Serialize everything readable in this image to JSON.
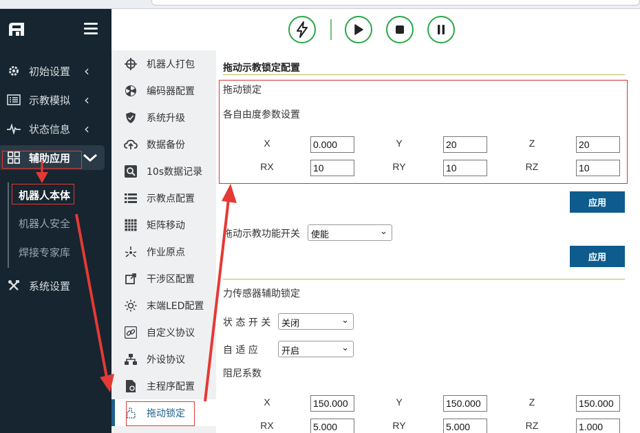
{
  "sidebar": {
    "items": [
      {
        "label": "初始设置",
        "icon": "gear-icon"
      },
      {
        "label": "示教模拟",
        "icon": "list-icon"
      },
      {
        "label": "状态信息",
        "icon": "pulse-icon"
      },
      {
        "label": "辅助应用",
        "icon": "grid-icon"
      },
      {
        "label": "系统设置",
        "icon": "tools-icon"
      }
    ],
    "sub_items": [
      "机器人本体",
      "机器人安全",
      "焊接专家库"
    ]
  },
  "toolbar": {
    "buttons": [
      "power-icon",
      "play-icon",
      "stop-icon",
      "pause-icon"
    ],
    "accent": "#27a844"
  },
  "menu2": {
    "items": [
      "机器人打包",
      "编码器配置",
      "系统升级",
      "数据备份",
      "10s数据记录",
      "示教点配置",
      "矩阵移动",
      "作业原点",
      "干涉区配置",
      "末端LED配置",
      "自定义协议",
      "外设协议",
      "主程序配置",
      "拖动锁定"
    ],
    "active": "拖动锁定"
  },
  "content": {
    "section1_title": "拖动示教锁定配置",
    "drag_lock_label": "拖动锁定",
    "dof_label": "各自由度参数设置",
    "axes1": {
      "X": "0.000",
      "Y": "20",
      "Z": "20",
      "RX": "10",
      "RY": "10",
      "RZ": "10"
    },
    "apply_label": "应用",
    "switch_label": "拖动示教功能开关",
    "switch_value": "使能",
    "apply2_label": "应用",
    "section2_title": "力传感器辅助锁定",
    "state_label": "状 态 开 关",
    "state_value": "关闭",
    "adaptive_label": "自 适 应",
    "adaptive_value": "开启",
    "damping_label": "阻尼系数",
    "axes2": {
      "X": "150.000",
      "Y": "150.000",
      "Z": "150.000",
      "RX": "5.000",
      "RY": "5.000",
      "RZ": "1.000"
    },
    "axis_names": {
      "X": "X",
      "Y": "Y",
      "Z": "Z",
      "RX": "RX",
      "RY": "RY",
      "RZ": "RZ"
    }
  },
  "colors": {
    "sidebar_bg": "#16252f",
    "apply_bg": "#0e5c8d",
    "annotation": "#e53935"
  }
}
